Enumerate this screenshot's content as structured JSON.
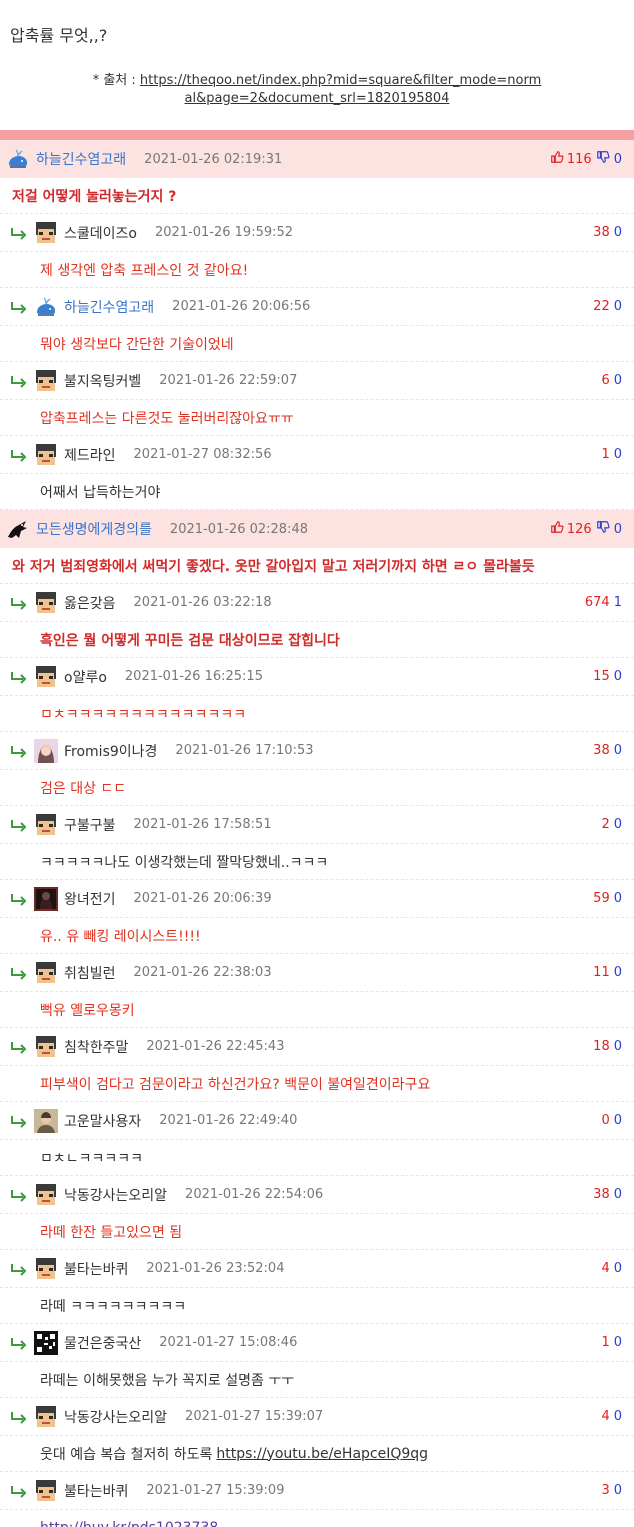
{
  "post": {
    "title": "압축률 무엇,,?",
    "source_prefix": "* 출처 : ",
    "source_line1": "https://theqoo.net/index.php?mid=square&filter_mode=norm",
    "source_line2": "al&page=2&document_srl=1820195804"
  },
  "colors": {
    "best_bg": "#fde2e2",
    "up": "#e01f1f",
    "down": "#2a3dd1",
    "nick_blue": "#3a74c8",
    "top_bar": "#f4a0a0"
  },
  "comments": [
    {
      "type": "best",
      "nick": "하늘긴수염고래",
      "nick_color": "blue",
      "avatar": "whale-icon",
      "date": "2021-01-26 02:19:31",
      "up": "116",
      "down": "0",
      "text": "저걸 어떻게 눌러놓는거지 ?",
      "style": "bold"
    },
    {
      "type": "reply",
      "nick": "스쿨데이즈o",
      "avatar": "pixel-face-icon",
      "date": "2021-01-26 19:59:52",
      "up": "38",
      "down": "0",
      "text": "제 생각엔 압축 프레스인 것 같아요!",
      "style": "red"
    },
    {
      "type": "reply",
      "nick": "하늘긴수염고래",
      "nick_color": "blue",
      "avatar": "whale-icon",
      "date": "2021-01-26 20:06:56",
      "up": "22",
      "down": "0",
      "text": "뭐야 생각보다 간단한 기술이었네",
      "style": "red"
    },
    {
      "type": "reply",
      "nick": "불지옥팅커벨",
      "avatar": "pixel-face-icon",
      "date": "2021-01-26 22:59:07",
      "up": "6",
      "down": "0",
      "text": "압축프레스는 다른것도 눌러버리잖아요ㅠㅠ",
      "style": "red"
    },
    {
      "type": "reply",
      "nick": "제드라인",
      "avatar": "pixel-face-icon",
      "date": "2021-01-27 08:32:56",
      "up": "1",
      "down": "0",
      "text": "어째서 납득하는거야",
      "style": "normal"
    },
    {
      "type": "best",
      "nick": "모든생명에게경의를",
      "nick_color": "blue",
      "avatar": "dark-creature-icon",
      "date": "2021-01-26 02:28:48",
      "up": "126",
      "down": "0",
      "text": "와 저거 범죄영화에서 써먹기 좋겠다. 옷만 갈아입지 말고 저러기까지 하면 ㄹㅇ 몰라볼듯",
      "style": "bold"
    },
    {
      "type": "reply",
      "nick": "옳은갖음",
      "avatar": "pixel-face-icon",
      "date": "2021-01-26 03:22:18",
      "up": "674",
      "down": "1",
      "text": "흑인은 뭘 어떻게 꾸미든 검문 대상이므로 잡힙니다",
      "style": "bold"
    },
    {
      "type": "reply",
      "nick": "o얄루o",
      "avatar": "pixel-face-icon",
      "date": "2021-01-26 16:25:15",
      "up": "15",
      "down": "0",
      "text": "ㅁㅊㅋㅋㅋㅋㅋㅋㅋㅋㅋㅋㅋㅋㅋㅋ",
      "style": "red"
    },
    {
      "type": "reply",
      "nick": "Fromis9이나경",
      "avatar": "photo-girl-icon",
      "date": "2021-01-26 17:10:53",
      "up": "38",
      "down": "0",
      "text": "검은 대상 ㄷㄷ",
      "style": "red"
    },
    {
      "type": "reply",
      "nick": "구불구불",
      "avatar": "pixel-face-icon",
      "date": "2021-01-26 17:58:51",
      "up": "2",
      "down": "0",
      "text": "ㅋㅋㅋㅋㅋ나도 이생각했는데 짤막당했네..ㅋㅋㅋ",
      "style": "normal"
    },
    {
      "type": "reply",
      "nick": "왕녀전기",
      "avatar": "dark-portrait-icon",
      "date": "2021-01-26 20:06:39",
      "up": "59",
      "down": "0",
      "text": "유.. 유 빼킹 레이시스트!!!!",
      "style": "red"
    },
    {
      "type": "reply",
      "nick": "취침빌런",
      "avatar": "pixel-face-icon",
      "date": "2021-01-26 22:38:03",
      "up": "11",
      "down": "0",
      "text": "뻑유 옐로우몽키",
      "style": "red"
    },
    {
      "type": "reply",
      "nick": "침착한주말",
      "avatar": "pixel-face-icon",
      "date": "2021-01-26 22:45:43",
      "up": "18",
      "down": "0",
      "text": "피부색이 검다고 검문이라고 하신건가요? 백문이 불여일견이라구요",
      "style": "red"
    },
    {
      "type": "reply",
      "nick": "고운말사용자",
      "avatar": "photo-person-icon",
      "date": "2021-01-26 22:49:40",
      "up": "0",
      "down": "0",
      "text": "ㅁㅊㄴㅋㅋㅋㅋㅋ",
      "style": "normal"
    },
    {
      "type": "reply",
      "nick": "낙동강사는오리알",
      "avatar": "pixel-face-icon",
      "date": "2021-01-26 22:54:06",
      "up": "38",
      "down": "0",
      "text": "라떼 한잔 들고있으면 됨",
      "style": "red"
    },
    {
      "type": "reply",
      "nick": "불타는바퀴",
      "avatar": "pixel-face-icon",
      "date": "2021-01-26 23:52:04",
      "up": "4",
      "down": "0",
      "text": "라떼 ㅋㅋㅋㅋㅋㅋㅋㅋㅋ",
      "style": "normal"
    },
    {
      "type": "reply",
      "nick": "물건은중국산",
      "avatar": "qr-pattern-icon",
      "date": "2021-01-27 15:08:46",
      "up": "1",
      "down": "0",
      "text": "라떼는 이해못했음 누가 꼭지로 설명좀 ㅜㅜ",
      "style": "normal"
    },
    {
      "type": "reply",
      "nick": "낙동강사는오리알",
      "avatar": "pixel-face-icon",
      "date": "2021-01-27 15:39:07",
      "up": "4",
      "down": "0",
      "text": "웃대 예습 복습 철저히 하도록",
      "link": "https://youtu.be/eHapceIQ9qg",
      "style": "normal"
    },
    {
      "type": "reply",
      "nick": "불타는바퀴",
      "avatar": "pixel-face-icon",
      "date": "2021-01-27 15:39:09",
      "up": "3",
      "down": "0",
      "text": "",
      "link": "http://huv.kr/pds1023738",
      "link_style": "purple",
      "style": "normal"
    }
  ]
}
